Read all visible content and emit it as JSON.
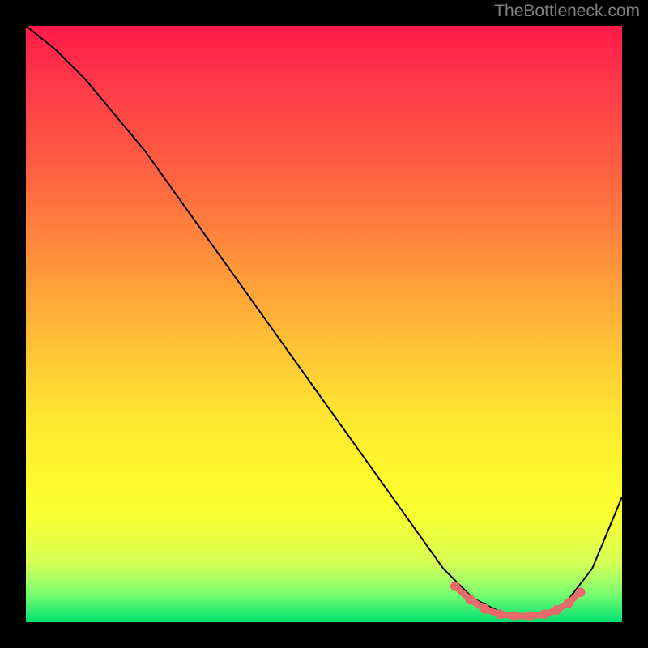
{
  "attribution": "TheBottleneck.com",
  "chart_data": {
    "type": "line",
    "title": "",
    "xlabel": "",
    "ylabel": "",
    "xlim": [
      0,
      100
    ],
    "ylim": [
      0,
      100
    ],
    "series": [
      {
        "name": "bottleneck-curve",
        "x": [
          0,
          5,
          10,
          15,
          20,
          25,
          30,
          35,
          40,
          45,
          50,
          55,
          60,
          65,
          70,
          75,
          80,
          85,
          90,
          95,
          100
        ],
        "y": [
          100,
          96,
          91,
          85,
          79,
          72,
          65,
          58,
          51,
          44,
          37,
          30,
          23,
          16,
          9,
          4,
          1.5,
          1,
          2.5,
          9,
          21
        ],
        "color": "#000000"
      },
      {
        "name": "optimal-zone-markers",
        "x": [
          72,
          74.5,
          77,
          79.5,
          82,
          84.5,
          87,
          89,
          91,
          93
        ],
        "y": [
          6.0,
          3.8,
          2.2,
          1.3,
          1.0,
          1.0,
          1.3,
          2.0,
          3.2,
          5.0
        ],
        "color": "#e86b6b"
      }
    ],
    "gradient": {
      "top_color": "#ff1a4a",
      "mid_color": "#ffe730",
      "bottom_color": "#00e070"
    }
  }
}
